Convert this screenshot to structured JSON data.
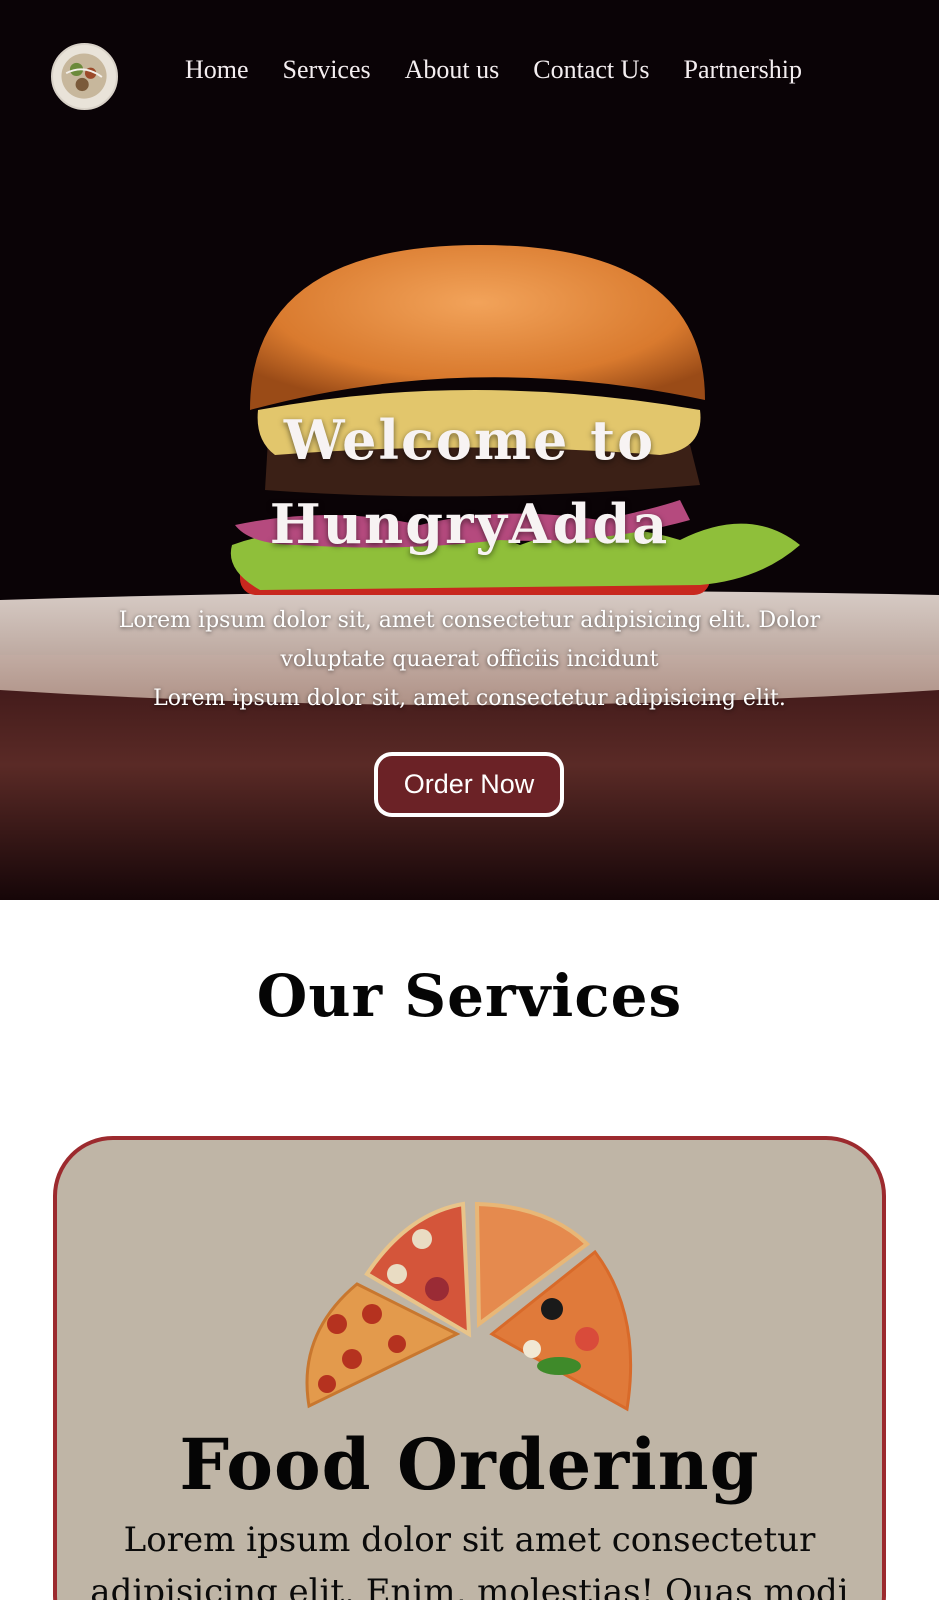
{
  "nav": {
    "logo_icon": "food-plate-logo-icon",
    "links": [
      "Home",
      "Services",
      "About us",
      "Contact Us",
      "Partnership"
    ]
  },
  "hero": {
    "title_line1": "Welcome to",
    "title_line2": "HungryAdda",
    "subtitle_line1": "Lorem ipsum dolor sit, amet consectetur adipisicing elit. Dolor",
    "subtitle_line2": "voluptate quaerat officiis incidunt",
    "subtitle_line3": "Lorem ipsum dolor sit, amet consectetur adipisicing elit.",
    "button_label": "Order Now",
    "image_icon": "burger-image"
  },
  "services": {
    "heading": "Our Services",
    "card": {
      "image_icon": "pizza-slices-image",
      "title": "Food Ordering",
      "text_line1": "Lorem ipsum dolor sit amet consectetur",
      "text_line2": "adipisicing elit. Enim, molestias! Quas modi"
    }
  },
  "colors": {
    "hero_bg": "#0a0306",
    "button_bg": "#6b2226",
    "card_bg": "#bfb5a6",
    "card_border": "#9c2a2e"
  }
}
